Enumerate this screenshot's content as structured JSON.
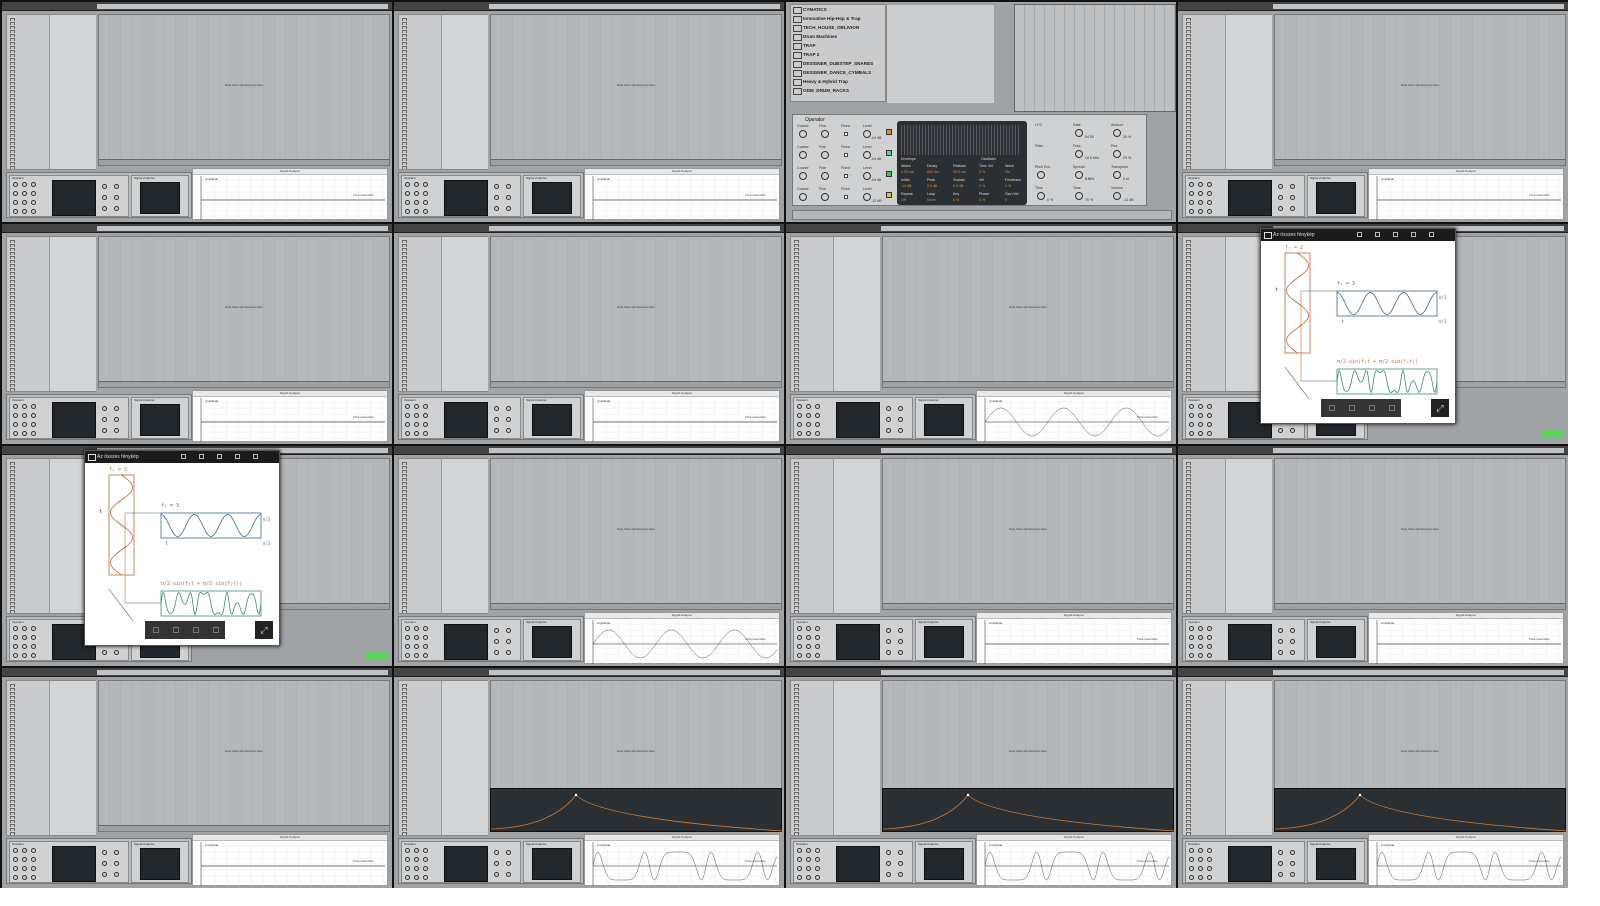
{
  "common": {
    "drop_text": "Drop Files and Devices Here",
    "analyzer_title": "Signal Analyzer",
    "analyzer_xlabel": "Time (seconds)",
    "analyzer_ylabel": "Amplitude",
    "device_operator": "Operator",
    "device_signal": "Signal Analyzer"
  },
  "tiles": [
    {
      "kind": "ableton",
      "analyzer": "flat",
      "envelope": false
    },
    {
      "kind": "ableton",
      "analyzer": "flat",
      "envelope": false
    },
    {
      "kind": "operator-zoom"
    },
    {
      "kind": "ableton",
      "analyzer": "flat",
      "envelope": false
    },
    {
      "kind": "ableton",
      "analyzer": "flat",
      "envelope": false
    },
    {
      "kind": "ableton",
      "analyzer": "flat",
      "envelope": false
    },
    {
      "kind": "ableton",
      "analyzer": "sine",
      "envelope": false
    },
    {
      "kind": "photo"
    },
    {
      "kind": "photo"
    },
    {
      "kind": "ableton",
      "analyzer": "sine",
      "envelope": false
    },
    {
      "kind": "ableton",
      "analyzer": "flat",
      "envelope": false
    },
    {
      "kind": "ableton",
      "analyzer": "flat",
      "envelope": false
    },
    {
      "kind": "ableton",
      "analyzer": "flat",
      "envelope": false
    },
    {
      "kind": "ableton",
      "analyzer": "burst",
      "envelope": true
    },
    {
      "kind": "ableton",
      "analyzer": "burst",
      "envelope": true
    },
    {
      "kind": "ableton",
      "analyzer": "burst",
      "envelope": true
    }
  ],
  "browser_folders": [
    "CYMATICS",
    "Innovative Hip-Hop & Trap",
    "TECH_HOUSE_OBLIVION",
    "Drum Machines",
    "TRAP",
    "TRAP 2",
    "DESIGNER_DUBSTEP_SNARES",
    "DESIGNER_DANCE_CYMBALS",
    "Heavy & Hybrid Trap",
    "ODM_DRUM_RACKS"
  ],
  "operator": {
    "title": "Operator",
    "osc_labels": [
      "Coarse",
      "Fine",
      "Fixed",
      "Level"
    ],
    "osc_levels": [
      "-inf dB",
      "-inf dB",
      "-inf dB",
      "-12 dB"
    ],
    "env_labels": [
      "Attack",
      "Decay",
      "Release",
      "Time Vel",
      "Wave",
      "Initial",
      "Peak",
      "Sustain",
      "Vel",
      "Feedback",
      "Repeat",
      "Loop",
      "Key",
      "Phase",
      "Osc<Vel"
    ],
    "env_values": [
      "0.00 ms",
      "600 ms",
      "50.0 ms",
      "0 %",
      "Sin",
      "-inf dB",
      "0.0 dB",
      "0.0 dB",
      "0 %",
      "0 %",
      "Off",
      "None",
      "0 %",
      "0 %",
      "0"
    ],
    "tabs": [
      "Envelope",
      "Oscillator"
    ],
    "right_labels": [
      "LFO",
      "Rate",
      "Amount",
      "Filter",
      "Freq",
      "Res",
      "Pitch Env",
      "Spread",
      "Transpose",
      "Time",
      "Tone",
      "Volume"
    ],
    "right_values": [
      "64.00",
      "25 %",
      "18.5 kHz",
      "20 %",
      "0.0 %",
      "0 %",
      "0 st",
      "0 %",
      "70 %",
      "-12 dB"
    ]
  },
  "photo_viewer": {
    "title": "Az összes fénykép",
    "f1": "f₁ = 2",
    "f2": "f₂ = 3",
    "t": "t",
    "pi2": "π/2",
    "formula": "π/2 sin(f₁t + π/2 sin(f₂t))"
  },
  "colors": {
    "orange": "#b86a3a",
    "blue": "#3f6a8a",
    "green": "#3f8f6a",
    "active": "#5fd05f"
  }
}
